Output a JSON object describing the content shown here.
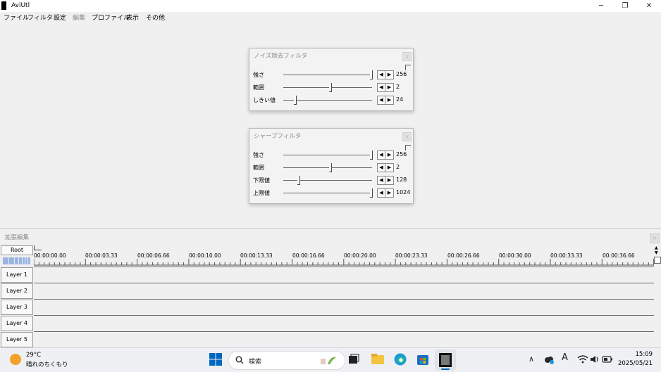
{
  "window": {
    "title": "AviUtl",
    "minimize_icon": "─",
    "maximize_icon": "❐",
    "close_icon": "✕"
  },
  "menu": [
    "ファイル",
    "フィルタ",
    "設定",
    "編集",
    "プロファイル",
    "表示",
    "その他"
  ],
  "noise_filter": {
    "title": "ノイズ除去フィルタ",
    "close_icon": "×",
    "rows": [
      {
        "label": "強さ",
        "value": "256",
        "fraction": 1.0
      },
      {
        "label": "範囲",
        "value": "2",
        "fraction": 0.53
      },
      {
        "label": "しきい値",
        "value": "24",
        "fraction": 0.12
      }
    ]
  },
  "sharp_filter": {
    "title": "シャープフィルタ",
    "close_icon": "×",
    "rows": [
      {
        "label": "強さ",
        "value": "256",
        "fraction": 1.0
      },
      {
        "label": "範囲",
        "value": "2",
        "fraction": 0.53
      },
      {
        "label": "下限値",
        "value": "128",
        "fraction": 0.16
      },
      {
        "label": "上限値",
        "value": "1024",
        "fraction": 1.0
      }
    ]
  },
  "timeline": {
    "title": "拡張編集",
    "close_icon": "×",
    "root_label": "Root",
    "ticks": [
      "00:00:00.00",
      "00:00:03.33",
      "00:00:06.66",
      "00:00:10.00",
      "00:00:13.33",
      "00:00:16.66",
      "00:00:20.00",
      "00:00:23.33",
      "00:00:26.66",
      "00:00:30.00",
      "00:00:33.33",
      "00:00:36.66"
    ],
    "layers": [
      "Layer 1",
      "Layer 2",
      "Layer 3",
      "Layer 4",
      "Layer 5"
    ]
  },
  "taskbar": {
    "temperature": "29°C",
    "weather": "晴れのちくもり",
    "search_placeholder": "検索",
    "clock_time": "15:09",
    "clock_date": "2025/05/21",
    "colors": {
      "accent": "#0067c0",
      "weather": "#f2a12b",
      "explorer": "#f4c342",
      "edge": "#1f9bd6"
    }
  }
}
